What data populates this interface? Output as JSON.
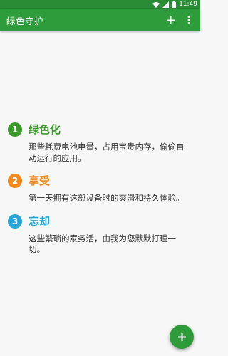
{
  "status_bar": {
    "time": "11:49",
    "icons": [
      "wifi-icon",
      "signal-icon",
      "battery-icon"
    ]
  },
  "app_bar": {
    "title": "绿色守护",
    "actions": [
      "add-icon",
      "more-vert-icon"
    ]
  },
  "features": [
    {
      "number": "1",
      "title": "绿色化",
      "description": "那些耗费电池电量，占用宝贵内存，偷偷自动运行的应用。",
      "color": "#3c9a2c"
    },
    {
      "number": "2",
      "title": "享受",
      "description": "第一天拥有这部设备时的爽滑和持久体验。",
      "color": "#f28a1e"
    },
    {
      "number": "3",
      "title": "忘却",
      "description": "这些繁琐的家务活，由我为您默默打理一切。",
      "color": "#2aa6d6"
    }
  ],
  "fab": {
    "icon": "add-icon"
  },
  "colors": {
    "primary": "#2f9c3b",
    "primary_dark": "#2a8c35",
    "background": "#f7f7f7"
  }
}
